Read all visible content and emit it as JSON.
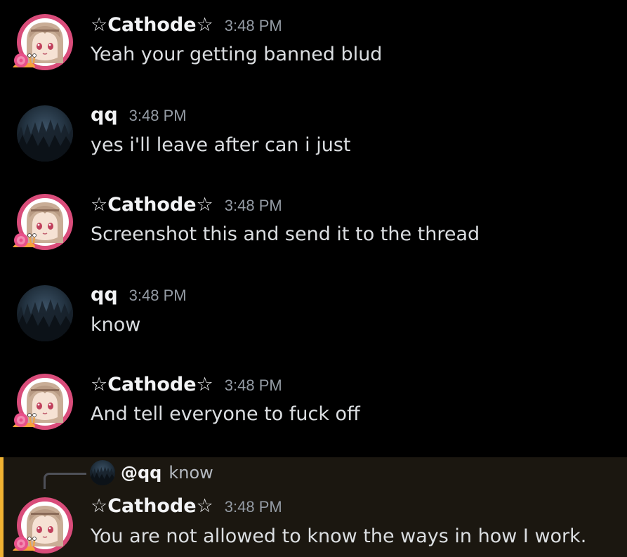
{
  "colors": {
    "background": "#000000",
    "username": "#f2f3f5",
    "timestamp": "#949ba4",
    "message_text": "#dbdee1",
    "mention_highlight_bg": "#1b1710",
    "mention_highlight_bar": "#f0b232"
  },
  "messages": [
    {
      "author": "☆Cathode☆",
      "avatar": "anime-girl-avatar",
      "time": "3:48 PM",
      "text": "Yeah your getting banned blud"
    },
    {
      "author": "qq",
      "avatar": "dark-forest-avatar",
      "time": "3:48 PM",
      "text": "yes i'll leave after can i just"
    },
    {
      "author": "☆Cathode☆",
      "avatar": "anime-girl-avatar",
      "time": "3:48 PM",
      "text": "Screenshot this and send it to the thread"
    },
    {
      "author": "qq",
      "avatar": "dark-forest-avatar",
      "time": "3:48 PM",
      "text": "know"
    },
    {
      "author": "☆Cathode☆",
      "avatar": "anime-girl-avatar",
      "time": "3:48 PM",
      "text": "And tell everyone to fuck off"
    },
    {
      "author": "☆Cathode☆",
      "avatar": "anime-girl-avatar",
      "time": "3:48 PM",
      "text": "You are not allowed to know the ways in how I work.",
      "reply": {
        "author": "@qq",
        "avatar": "dark-forest-avatar",
        "text": "know"
      }
    }
  ]
}
